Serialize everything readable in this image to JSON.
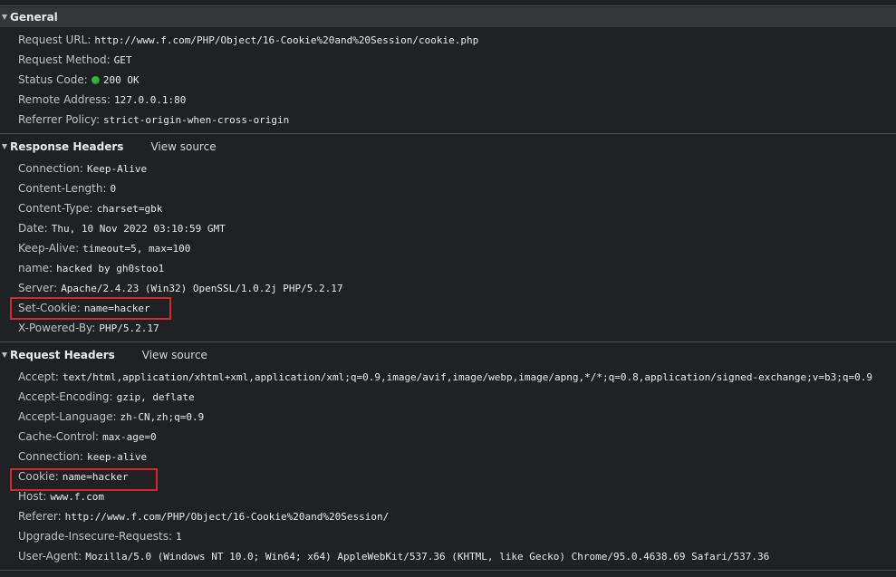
{
  "sections": {
    "general": {
      "title": "General",
      "rows": [
        {
          "key": "Request URL:",
          "value": "http://www.f.com/PHP/Object/16-Cookie%20and%20Session/cookie.php"
        },
        {
          "key": "Request Method:",
          "value": "GET"
        },
        {
          "key": "Status Code:",
          "value": "200 OK",
          "status_color": "#2bbf34"
        },
        {
          "key": "Remote Address:",
          "value": "127.0.0.1:80"
        },
        {
          "key": "Referrer Policy:",
          "value": "strict-origin-when-cross-origin"
        }
      ]
    },
    "response_headers": {
      "title": "Response Headers",
      "view_source": "View source",
      "rows": [
        {
          "key": "Connection:",
          "value": "Keep-Alive"
        },
        {
          "key": "Content-Length:",
          "value": "0"
        },
        {
          "key": "Content-Type:",
          "value": "charset=gbk"
        },
        {
          "key": "Date:",
          "value": "Thu, 10 Nov 2022 03:10:59 GMT"
        },
        {
          "key": "Keep-Alive:",
          "value": "timeout=5, max=100"
        },
        {
          "key": "name:",
          "value": "hacked by gh0stoo1"
        },
        {
          "key": "Server:",
          "value": "Apache/2.4.23 (Win32) OpenSSL/1.0.2j PHP/5.2.17"
        },
        {
          "key": "Set-Cookie:",
          "value": "name=hacker"
        },
        {
          "key": "X-Powered-By:",
          "value": "PHP/5.2.17"
        }
      ]
    },
    "request_headers": {
      "title": "Request Headers",
      "view_source": "View source",
      "rows": [
        {
          "key": "Accept:",
          "value": "text/html,application/xhtml+xml,application/xml;q=0.9,image/avif,image/webp,image/apng,*/*;q=0.8,application/signed-exchange;v=b3;q=0.9"
        },
        {
          "key": "Accept-Encoding:",
          "value": "gzip, deflate"
        },
        {
          "key": "Accept-Language:",
          "value": "zh-CN,zh;q=0.9"
        },
        {
          "key": "Cache-Control:",
          "value": "max-age=0"
        },
        {
          "key": "Connection:",
          "value": "keep-alive"
        },
        {
          "key": "Cookie:",
          "value": "name=hacker"
        },
        {
          "key": "Host:",
          "value": "www.f.com"
        },
        {
          "key": "Referer:",
          "value": "http://www.f.com/PHP/Object/16-Cookie%20and%20Session/"
        },
        {
          "key": "Upgrade-Insecure-Requests:",
          "value": "1"
        },
        {
          "key": "User-Agent:",
          "value": "Mozilla/5.0 (Windows NT 10.0; Win64; x64) AppleWebKit/537.36 (KHTML, like Gecko) Chrome/95.0.4638.69 Safari/537.36"
        }
      ]
    }
  },
  "highlight_color": "#d22a2a"
}
